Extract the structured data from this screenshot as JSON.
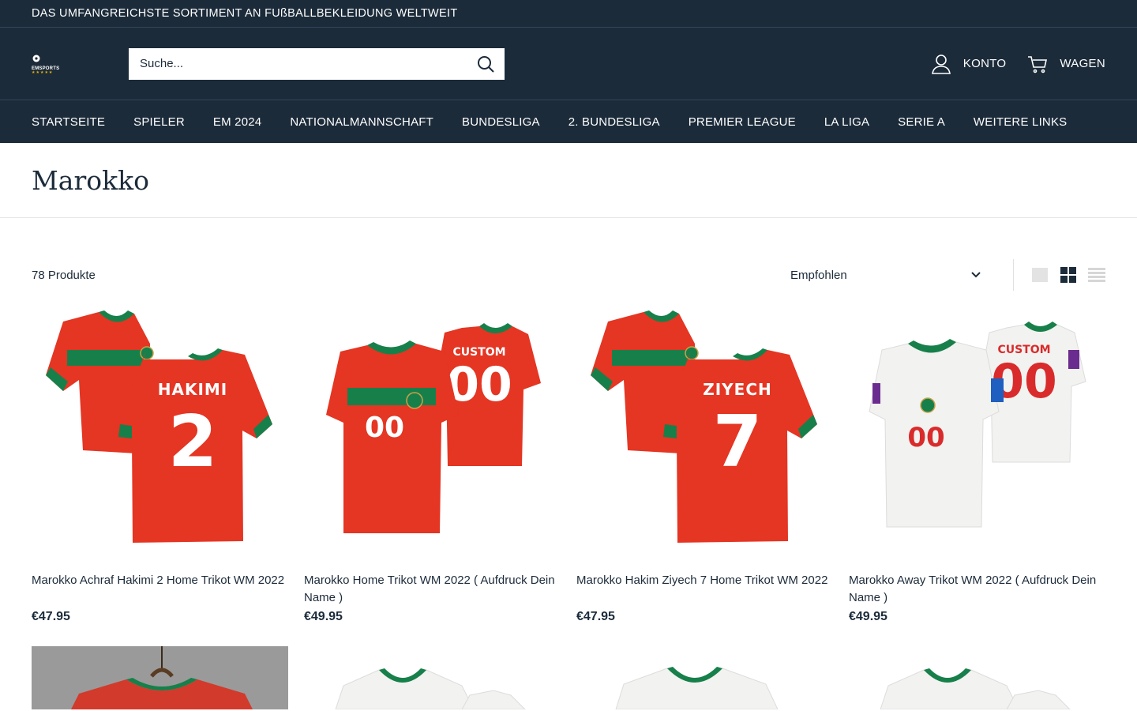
{
  "announcement": "DAS UMFANGREICHSTE SORTIMENT AN FUßBALLBEKLEIDUNG WELTWEIT",
  "logo": {
    "text": "EMSPORTS",
    "stars": "★★★★★"
  },
  "search": {
    "placeholder": "Suche..."
  },
  "header_links": {
    "account": "KONTO",
    "cart": "WAGEN"
  },
  "nav": [
    "STARTSEITE",
    "SPIELER",
    "EM 2024",
    "NATIONALMANNSCHAFT",
    "BUNDESLIGA",
    "2. BUNDESLIGA",
    "PREMIER LEAGUE",
    "LA LIGA",
    "SERIE A",
    "WEITERE LINKS"
  ],
  "page_title": "Marokko",
  "product_count": "78 Produkte",
  "sort": {
    "selected": "Empfohlen"
  },
  "colors": {
    "navy": "#1c2b3a",
    "jersey_red": "#e53523",
    "jersey_green": "#17804a",
    "white_kit": "#f2f2f0"
  },
  "products": [
    {
      "name": "Marokko Achraf Hakimi 2 Home Trikot WM 2022",
      "price": "€47.95",
      "back_name": "HAKIMI",
      "back_num": "2",
      "kit": "home"
    },
    {
      "name": "Marokko Home Trikot WM 2022 ( Aufdruck Dein Name )",
      "price": "€49.95",
      "back_name": "CUSTOM",
      "back_num": "00",
      "kit": "home"
    },
    {
      "name": "Marokko Hakim Ziyech 7 Home Trikot WM 2022",
      "price": "€47.95",
      "back_name": "ZIYECH",
      "back_num": "7",
      "kit": "home"
    },
    {
      "name": "Marokko Away Trikot WM 2022 ( Aufdruck Dein Name )",
      "price": "€49.95",
      "back_name": "CUSTOM",
      "back_num": "00",
      "kit": "away"
    }
  ]
}
